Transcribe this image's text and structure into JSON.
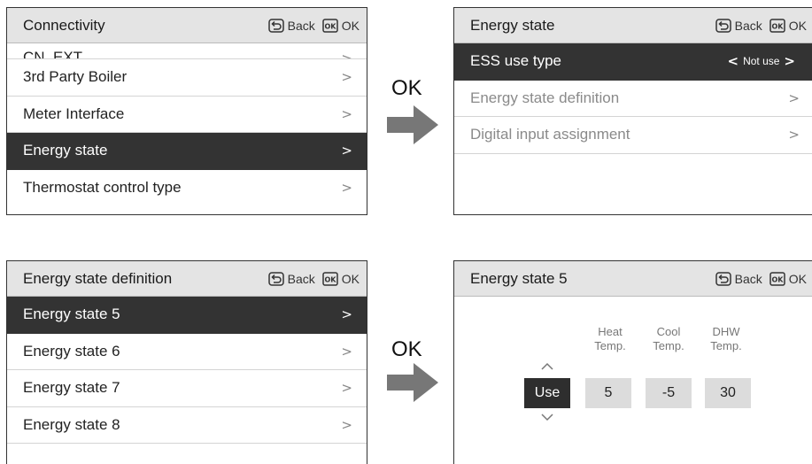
{
  "header_buttons": {
    "back_label": "Back",
    "ok_label": "OK"
  },
  "icons": {
    "back": "back-return-icon",
    "ok": "ok-key-icon",
    "arrow": "right-arrow-icon",
    "chevron": "chevron-right-icon"
  },
  "colors": {
    "selected_row": "#333333",
    "header_bg": "#e4e4e4",
    "arrow": "#777777"
  },
  "connectivity": {
    "title": "Connectivity",
    "items": [
      {
        "label": "CN_EXT",
        "chevron": ">"
      },
      {
        "label": "3rd Party Boiler",
        "chevron": ">"
      },
      {
        "label": "Meter Interface",
        "chevron": ">"
      },
      {
        "label": "Energy state",
        "chevron": ">"
      },
      {
        "label": "Thermostat control type",
        "chevron": ">"
      }
    ]
  },
  "energy_state": {
    "title": "Energy state",
    "ess_row": {
      "label": "ESS use type",
      "value": "Not use",
      "prev": "<",
      "next": ">"
    },
    "items": [
      {
        "label": "Energy state definition",
        "chevron": ">"
      },
      {
        "label": "Digital input assignment",
        "chevron": ">"
      }
    ]
  },
  "energy_state_definition": {
    "title": "Energy state definition",
    "items": [
      {
        "label": "Energy state 5",
        "chevron": ">"
      },
      {
        "label": "Energy state 6",
        "chevron": ">"
      },
      {
        "label": "Energy state 7",
        "chevron": ">"
      },
      {
        "label": "Energy state 8",
        "chevron": ">"
      }
    ]
  },
  "energy_state_5": {
    "title": "Energy state 5",
    "columns": [
      {
        "line1": "Heat",
        "line2": "Temp.",
        "value": "5"
      },
      {
        "line1": "Cool",
        "line2": "Temp.",
        "value": "-5"
      },
      {
        "line1": "DHW",
        "line2": "Temp.",
        "value": "30"
      }
    ],
    "use_value": "Use"
  },
  "transitions": {
    "ok_top": "OK",
    "ok_bottom": "OK"
  }
}
